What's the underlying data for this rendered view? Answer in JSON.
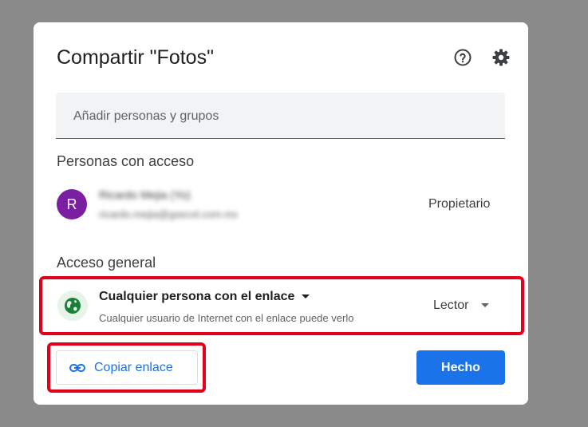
{
  "dialog": {
    "title": "Compartir \"Fotos\"",
    "help_icon": "help-circle-icon",
    "settings_icon": "gear-icon",
    "add_people_placeholder": "Añadir personas y grupos",
    "people_section_title": "Personas con acceso",
    "owner": {
      "initial": "R",
      "name": "Ricardo Mejia (Yo)",
      "email": "ricardo.mejia@gsecol.com.mx",
      "role": "Propietario",
      "avatar_color": "#7b1fa2"
    },
    "general_section_title": "Acceso general",
    "general_access": {
      "icon": "globe-icon",
      "type": "Cualquier persona con el enlace",
      "description": "Cualquier usuario de Internet con el enlace puede verlo",
      "role": "Lector"
    },
    "copy_link_label": "Copiar enlace",
    "copy_link_icon": "link-icon",
    "done_label": "Hecho"
  },
  "colors": {
    "accent": "#1a73e8",
    "highlight": "#e3001b",
    "globe_green": "#188038"
  }
}
